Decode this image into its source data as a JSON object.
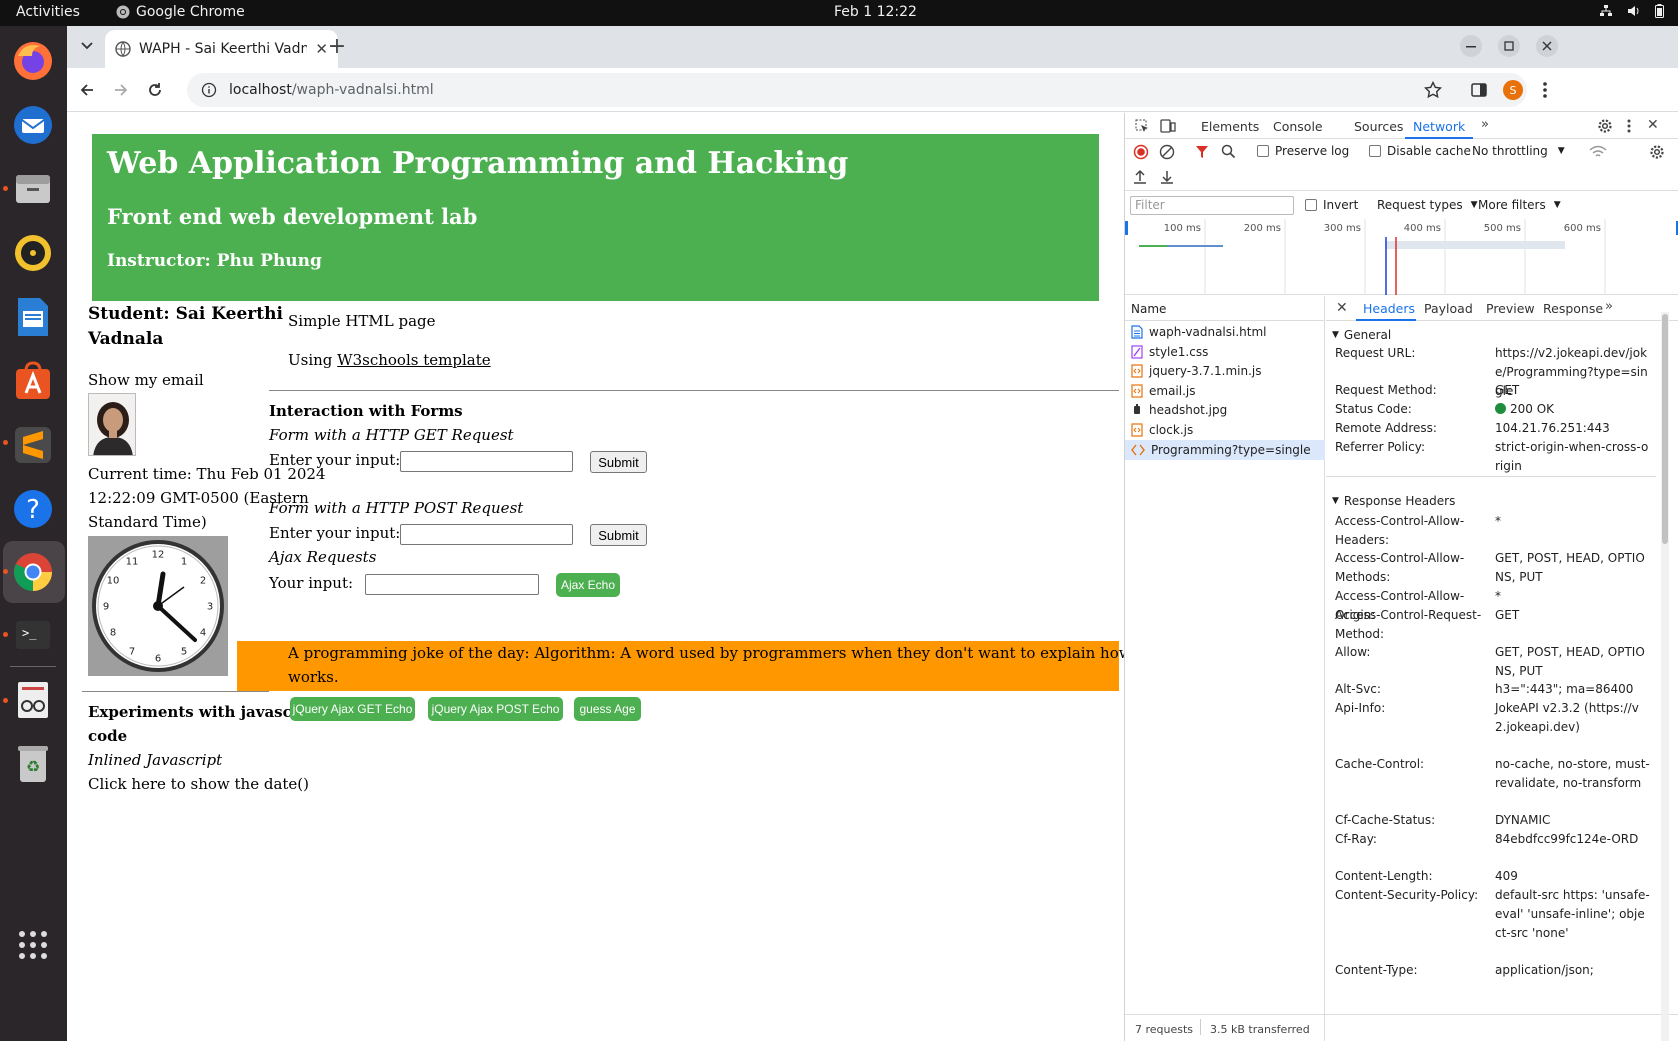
{
  "system": {
    "activities": "Activities",
    "app_name": "Google Chrome",
    "clock": "Feb 1  12:22"
  },
  "browser": {
    "tab_title": "WAPH - Sai Keerthi Vadnalsi",
    "url_host": "localhost",
    "url_path": "/waph-vadnalsi.html",
    "profile_initial": "S"
  },
  "page": {
    "title": "Web Application Programming and Hacking",
    "subtitle": "Front end web development lab",
    "instructor": "Instructor: Phu Phung",
    "student_line1": "Student: Sai Keerthi",
    "student_line2": "Vadnala",
    "show_email": "Show my email",
    "time_line1": "Current time: Thu Feb 01 2024",
    "time_line2": "12:22:09 GMT-0500 (Eastern",
    "time_line3": "Standard Time)",
    "simple_html": "Simple HTML page",
    "using_prefix": "Using ",
    "using_link": "W3schools template",
    "forms_heading": "Interaction with Forms",
    "get_heading": "Form with a HTTP GET Request",
    "get_label": "Enter your input:",
    "submit": "Submit",
    "post_heading": "Form with a HTTP POST Request",
    "post_label": "Enter your input:",
    "ajax_heading": "Ajax Requests",
    "ajax_label": "Your input:",
    "ajax_echo": "Ajax Echo",
    "joke_line1": "A programming joke of the day: Algorithm: A word used by programmers when they don't want to explain how their code",
    "joke_line2": "works.",
    "jq_get": "jQuery Ajax GET Echo",
    "jq_post": "jQuery Ajax POST Echo",
    "guess_age": "guess Age",
    "experiments_line1": "Experiments with javascript",
    "experiments_line2": "code",
    "inlined_js": "Inlined Javascript",
    "click_date": "Click here to show the date()",
    "clock_numbers": [
      "12",
      "1",
      "2",
      "3",
      "4",
      "5",
      "6",
      "7",
      "8",
      "9",
      "10",
      "11"
    ]
  },
  "devtools": {
    "tabs": [
      "Elements",
      "Console",
      "Sources",
      "Network"
    ],
    "active_tab": "Network",
    "preserve_log": "Preserve log",
    "disable_cache": "Disable cache",
    "throttling": "No throttling",
    "filter_placeholder": "Filter",
    "invert": "Invert",
    "request_types": "Request types",
    "more_filters": "More filters",
    "timeline_ticks": [
      "100 ms",
      "200 ms",
      "300 ms",
      "400 ms",
      "500 ms",
      "600 ms"
    ],
    "name_header": "Name",
    "requests": [
      {
        "name": "waph-vadnalsi.html",
        "icon": "document-icon"
      },
      {
        "name": "style1.css",
        "icon": "stylesheet-icon"
      },
      {
        "name": "jquery-3.7.1.min.js",
        "icon": "script-icon"
      },
      {
        "name": "email.js",
        "icon": "script-icon"
      },
      {
        "name": "headshot.jpg",
        "icon": "image-icon"
      },
      {
        "name": "clock.js",
        "icon": "script-icon"
      },
      {
        "name": "Programming?type=single",
        "icon": "fetch-icon"
      }
    ],
    "detail_tabs": [
      "Headers",
      "Payload",
      "Preview",
      "Response"
    ],
    "general_title": "General",
    "general": [
      {
        "k": "Request URL:",
        "v": "https://v2.jokeapi.dev/joke/Programming?type=single"
      },
      {
        "k": "Request Method:",
        "v": "GET"
      },
      {
        "k": "Status Code:",
        "v": "200 OK"
      },
      {
        "k": "Remote Address:",
        "v": "104.21.76.251:443"
      },
      {
        "k": "Referrer Policy:",
        "v": "strict-origin-when-cross-origin"
      }
    ],
    "response_title": "Response Headers",
    "response": [
      {
        "k": "Access-Control-Allow-Headers:",
        "v": "*"
      },
      {
        "k": "Access-Control-Allow-Methods:",
        "v": "GET, POST, HEAD, OPTIONS, PUT"
      },
      {
        "k": "Access-Control-Allow-Origin:",
        "v": "*"
      },
      {
        "k": "Access-Control-Request-Method:",
        "v": "GET"
      },
      {
        "k": "Allow:",
        "v": "GET, POST, HEAD, OPTIONS, PUT"
      },
      {
        "k": "Alt-Svc:",
        "v": "h3=\":443\"; ma=86400"
      },
      {
        "k": "Api-Info:",
        "v": "JokeAPI v2.3.2 (https://v2.jokeapi.dev)"
      },
      {
        "k": "Cache-Control:",
        "v": "no-cache, no-store, must-revalidate, no-transform"
      },
      {
        "k": "Cf-Cache-Status:",
        "v": "DYNAMIC"
      },
      {
        "k": "Cf-Ray:",
        "v": "84ebdfcc99fc124e-ORD"
      },
      {
        "k": "Content-Length:",
        "v": "409"
      },
      {
        "k": "Content-Security-Policy:",
        "v": "default-src https: 'unsafe-eval' 'unsafe-inline'; object-src 'none'"
      },
      {
        "k": "Content-Type:",
        "v": "application/json;"
      }
    ],
    "status_requests": "7 requests",
    "status_transferred": "3.5 kB transferred"
  },
  "colors": {
    "header_green": "#4caf50",
    "joke_orange": "#ff9800",
    "devtools_blue": "#1a73e8",
    "ubuntu_orange": "#e95420"
  }
}
